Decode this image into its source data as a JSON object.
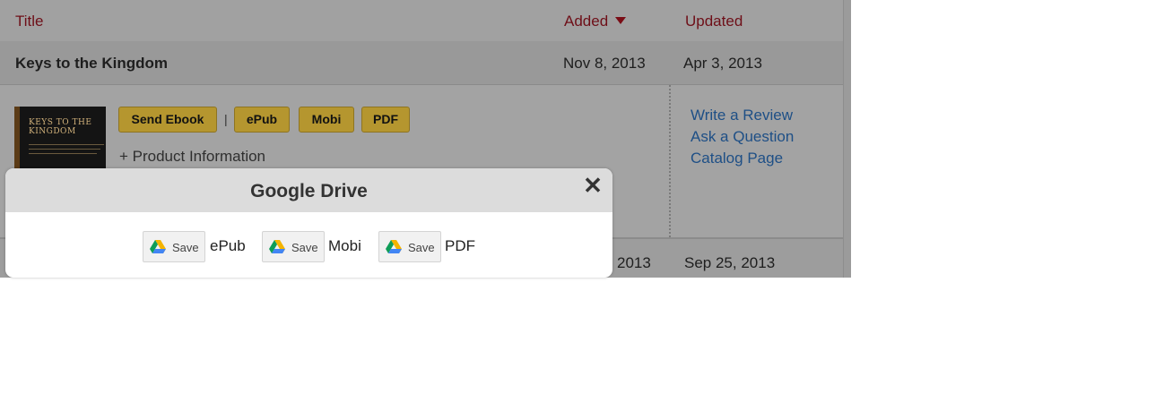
{
  "table": {
    "headers": {
      "title": "Title",
      "added": "Added",
      "updated": "Updated"
    },
    "rows": [
      {
        "title": "Keys to the Kingdom",
        "added": "Nov 8, 2013",
        "updated": "Apr 3, 2013"
      },
      {
        "title": "",
        "added": "2013",
        "updated": "Sep 25, 2013"
      }
    ]
  },
  "book_detail": {
    "cover_text": "KEYS TO THE KINGDOM",
    "buttons": {
      "send_ebook": "Send Ebook",
      "separator": "|",
      "epub": "ePub",
      "mobi": "Mobi",
      "pdf": "PDF"
    },
    "product_info": "+ Product Information",
    "links": {
      "review": "Write a Review",
      "question": "Ask a Question",
      "catalog": "Catalog Page"
    }
  },
  "modal": {
    "title": "Google Drive",
    "close_glyph": "✕",
    "save_items": [
      {
        "button": "Save",
        "label": "ePub"
      },
      {
        "button": "Save",
        "label": "Mobi"
      },
      {
        "button": "Save",
        "label": "PDF"
      }
    ]
  },
  "colors": {
    "header_link": "#6e0f18",
    "gold_button": "#b5962f",
    "link_blue": "#1e4f86",
    "drive_green": "#0f9d58",
    "drive_yellow": "#f4b400",
    "drive_blue": "#4285f4"
  }
}
